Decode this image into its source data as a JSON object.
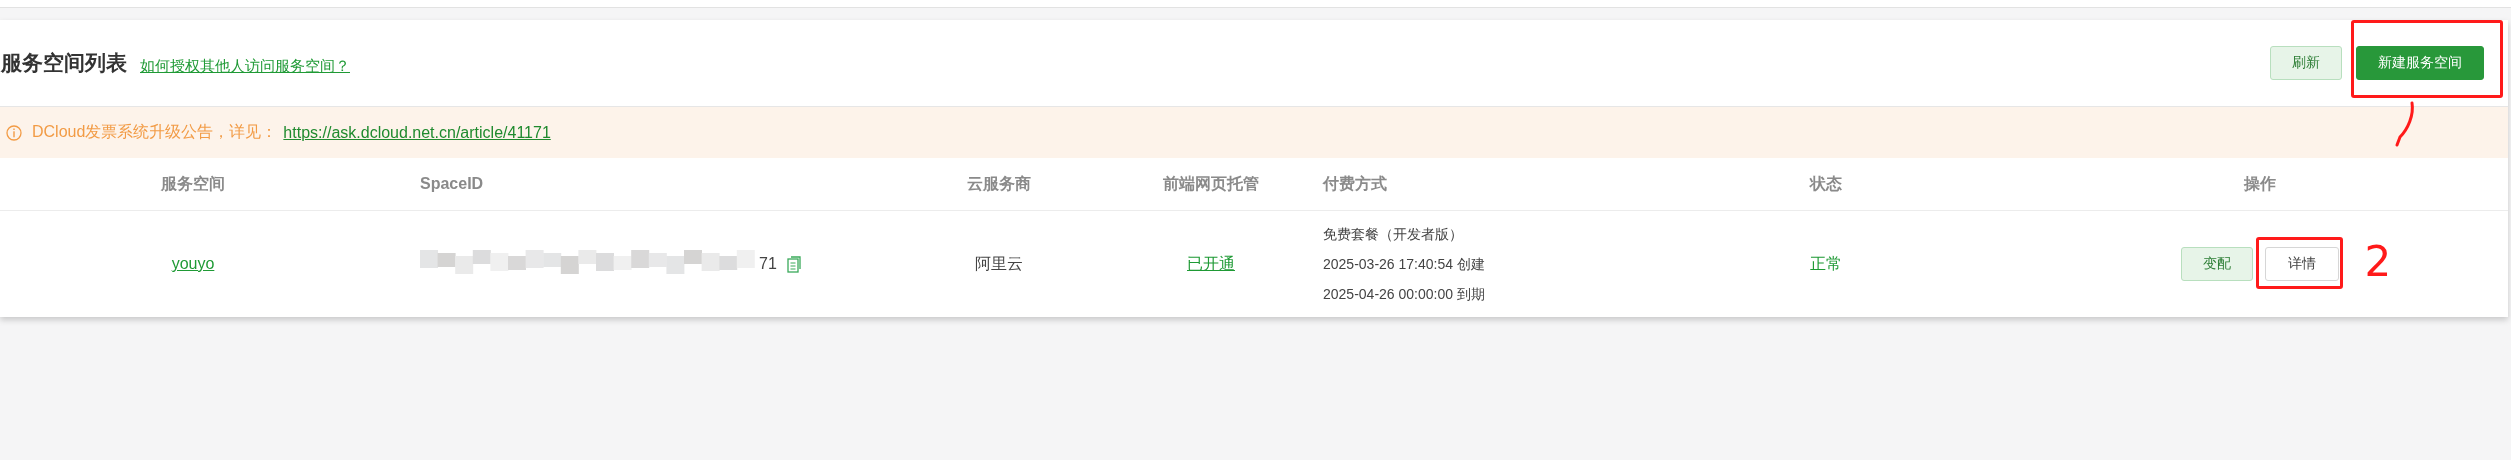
{
  "header": {
    "title": "服务空间列表",
    "help_link": "如何授权其他人访问服务空间？",
    "buttons": [
      {
        "label": "刷新",
        "kind": "secondary",
        "highlighted": false
      },
      {
        "label": "新建服务空间",
        "kind": "primary",
        "highlighted": true,
        "mark": {
          "kind": "stroke"
        }
      }
    ]
  },
  "notice": {
    "text": "DCloud发票系统升级公告，详见：",
    "link": "https://ask.dcloud.net.cn/article/41171"
  },
  "table": {
    "columns": [
      "服务空间",
      "SpaceID",
      "云服务商",
      "前端网页托管",
      "付费方式",
      "状态",
      "操作"
    ],
    "rows": [
      {
        "name": "youyo",
        "space_id_tail": "71",
        "provider": "阿里云",
        "hosting": "已开通",
        "payment": [
          "免费套餐（开发者版）",
          "2025-03-26 17:40:54 创建",
          "2025-04-26 00:00:00 到期"
        ],
        "status": "正常",
        "actions": [
          {
            "label": "变配",
            "kind": "secondary",
            "highlighted": false
          },
          {
            "label": "详情",
            "kind": "plain",
            "highlighted": true,
            "mark": {
              "kind": "digit",
              "text": "2"
            }
          }
        ]
      }
    ]
  }
}
